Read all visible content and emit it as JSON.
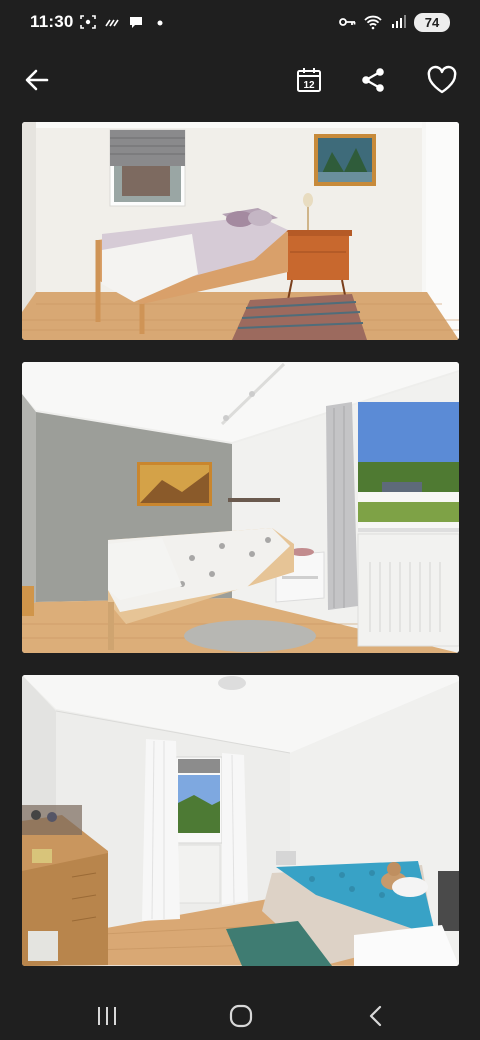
{
  "status_bar": {
    "time": "11:30",
    "battery": "74",
    "icons": [
      "screenshot-icon",
      "signal-assist-icon",
      "chat-bubble-icon",
      "notification-dot-icon",
      "vpn-key-icon",
      "wifi-icon",
      "cell-signal-icon",
      "battery-icon"
    ]
  },
  "app_bar": {
    "icons": [
      "back-arrow-icon",
      "calendar-icon",
      "share-icon",
      "heart-icon"
    ],
    "calendar_day": "12"
  },
  "gallery": {
    "photos": [
      {
        "name": "bedroom-photo-1"
      },
      {
        "name": "bedroom-photo-2"
      },
      {
        "name": "bedroom-photo-3"
      }
    ]
  },
  "nav_bar": {
    "icons": [
      "recent-apps-icon",
      "home-icon",
      "back-icon"
    ]
  },
  "colors": {
    "background": "#1f1f1f",
    "icon": "#ffffff",
    "battery_badge": "#ededed"
  }
}
